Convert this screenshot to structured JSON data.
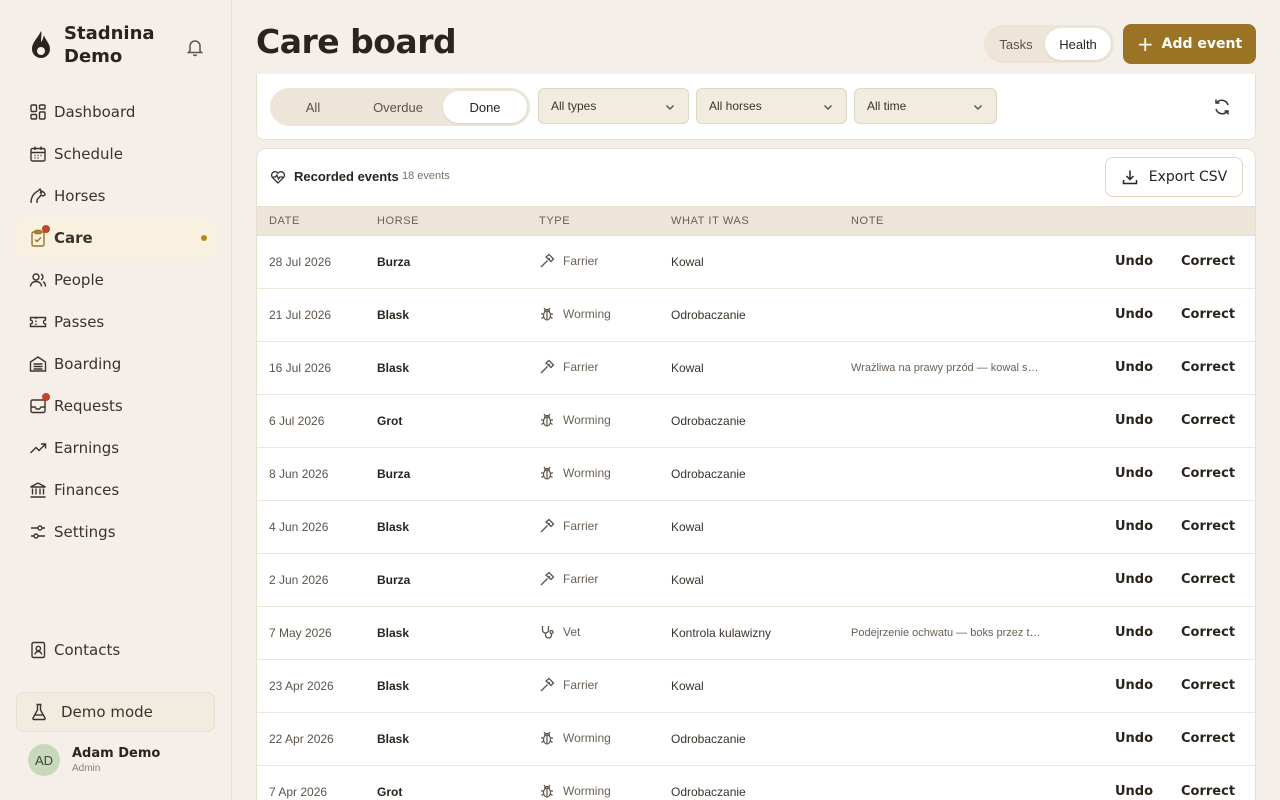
{
  "sidebar": {
    "brand": "Stadnina Demo",
    "items": [
      {
        "label": "Dashboard",
        "icon": "grid-icon"
      },
      {
        "label": "Schedule",
        "icon": "calendar-icon"
      },
      {
        "label": "Horses",
        "icon": "horse-icon"
      },
      {
        "label": "Care",
        "icon": "clipboard-check-icon",
        "active": true,
        "badge": true
      },
      {
        "label": "People",
        "icon": "people-icon"
      },
      {
        "label": "Passes",
        "icon": "ticket-icon"
      },
      {
        "label": "Boarding",
        "icon": "stable-icon"
      },
      {
        "label": "Requests",
        "icon": "inbox-icon",
        "badge": true
      },
      {
        "label": "Earnings",
        "icon": "trend-up-icon"
      },
      {
        "label": "Finances",
        "icon": "bank-icon"
      },
      {
        "label": "Settings",
        "icon": "sliders-icon"
      }
    ],
    "contacts": "Contacts",
    "demo_mode": "Demo mode",
    "user": {
      "initials": "AD",
      "name": "Adam Demo",
      "role": "Admin"
    }
  },
  "header": {
    "title": "Care board",
    "view_toggle": [
      "Tasks",
      "Health"
    ],
    "view_selected": "Health",
    "add_button": "Add event"
  },
  "filters": {
    "status": [
      "All",
      "Overdue",
      "Done"
    ],
    "status_selected": "Done",
    "type_select": "All types",
    "horse_select": "All horses",
    "time_select": "All time"
  },
  "table": {
    "title": "Recorded events",
    "count": "18 events",
    "export": "Export CSV",
    "columns": [
      "DATE",
      "HORSE",
      "TYPE",
      "WHAT IT WAS",
      "NOTE"
    ],
    "undo_label": "Undo",
    "correct_label": "Correct",
    "rows": [
      {
        "date": "28 Jul 2026",
        "horse": "Burza",
        "type": "Farrier",
        "icon": "hammer-icon",
        "what": "Kowal",
        "note": ""
      },
      {
        "date": "21 Jul 2026",
        "horse": "Blask",
        "type": "Worming",
        "icon": "bug-icon",
        "what": "Odrobaczanie",
        "note": ""
      },
      {
        "date": "16 Jul 2026",
        "horse": "Blask",
        "type": "Farrier",
        "icon": "hammer-icon",
        "what": "Kowal",
        "note": "Wrażliwa na prawy przód — kowal s…"
      },
      {
        "date": "6 Jul 2026",
        "horse": "Grot",
        "type": "Worming",
        "icon": "bug-icon",
        "what": "Odrobaczanie",
        "note": ""
      },
      {
        "date": "8 Jun 2026",
        "horse": "Burza",
        "type": "Worming",
        "icon": "bug-icon",
        "what": "Odrobaczanie",
        "note": ""
      },
      {
        "date": "4 Jun 2026",
        "horse": "Blask",
        "type": "Farrier",
        "icon": "hammer-icon",
        "what": "Kowal",
        "note": ""
      },
      {
        "date": "2 Jun 2026",
        "horse": "Burza",
        "type": "Farrier",
        "icon": "hammer-icon",
        "what": "Kowal",
        "note": ""
      },
      {
        "date": "7 May 2026",
        "horse": "Blask",
        "type": "Vet",
        "icon": "stethoscope-icon",
        "what": "Kontrola kulawizny",
        "note": "Podejrzenie ochwatu — boks przez t…"
      },
      {
        "date": "23 Apr 2026",
        "horse": "Blask",
        "type": "Farrier",
        "icon": "hammer-icon",
        "what": "Kowal",
        "note": ""
      },
      {
        "date": "22 Apr 2026",
        "horse": "Blask",
        "type": "Worming",
        "icon": "bug-icon",
        "what": "Odrobaczanie",
        "note": ""
      },
      {
        "date": "7 Apr 2026",
        "horse": "Grot",
        "type": "Worming",
        "icon": "bug-icon",
        "what": "Odrobaczanie",
        "note": ""
      }
    ]
  },
  "colors": {
    "accent": "#9a7424",
    "badge": "#c2432e",
    "background": "#f4f0e9"
  }
}
